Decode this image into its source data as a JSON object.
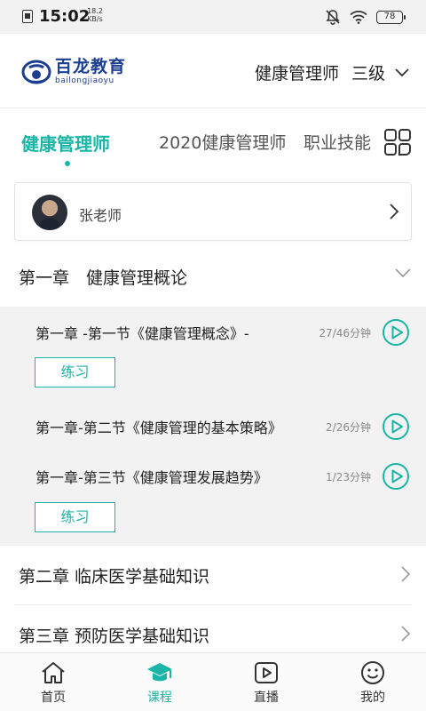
{
  "status_bar": {
    "time": "15:02",
    "speed_value": "18.2",
    "speed_unit": "KB/s",
    "battery": "78"
  },
  "header": {
    "logo_cn": "百龙教育",
    "logo_en": "bailongjiaoyu",
    "cert_name": "健康管理师",
    "cert_level": "三级"
  },
  "tabs": [
    {
      "label": "健康管理师",
      "active": true
    },
    {
      "label": "2020健康管理师",
      "active": false
    },
    {
      "label": "职业技能",
      "active": false
    }
  ],
  "teacher": {
    "name": "张老师"
  },
  "chapters": [
    {
      "title": "第一章　健康管理概论",
      "expanded": true,
      "lessons": [
        {
          "title": "第一章 -第一节《健康管理概念》-",
          "duration": "27/46分钟"
        },
        {
          "title": "第一章-第二节《健康管理的基本策略》",
          "duration": "2/26分钟"
        },
        {
          "title": "第一章-第三节《健康管理发展趋势》",
          "duration": "1/23分钟"
        }
      ],
      "practice_label": "练习"
    },
    {
      "title": "第二章 临床医学基础知识",
      "expanded": false
    },
    {
      "title": "第三章 预防医学基础知识",
      "expanded": false
    }
  ],
  "bottom_nav": [
    {
      "label": "首页",
      "icon": "home-icon",
      "active": false
    },
    {
      "label": "课程",
      "icon": "graduation-cap-icon",
      "active": true
    },
    {
      "label": "直播",
      "icon": "play-screen-icon",
      "active": false
    },
    {
      "label": "我的",
      "icon": "smiley-icon",
      "active": false
    }
  ],
  "colors": {
    "accent": "#1ab5a6",
    "brand": "#1b3e8f",
    "lesson_bg": "#f2f2f2"
  }
}
